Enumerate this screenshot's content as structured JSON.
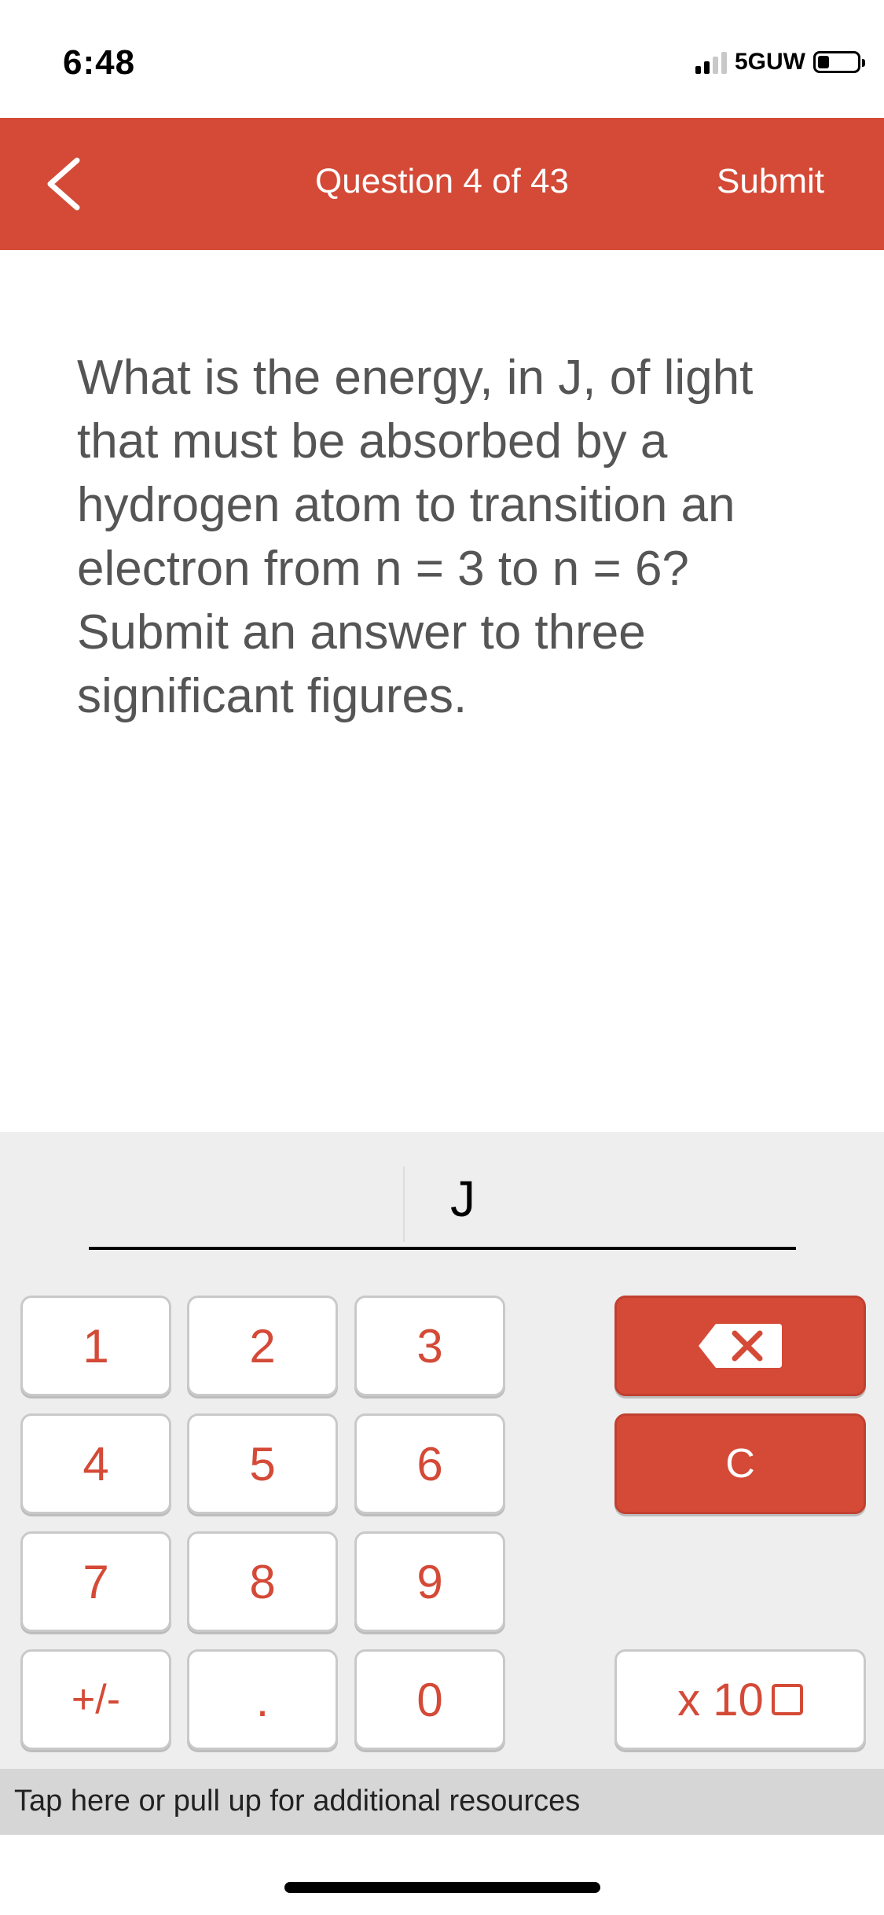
{
  "status_bar": {
    "time": "6:48",
    "network": "5GUW",
    "signal_bars_active": 2,
    "signal_bars_total": 4,
    "battery_level": 0.2
  },
  "header": {
    "back_icon": "chevron-left-icon",
    "title": "Question 4 of 43",
    "submit_label": "Submit",
    "color": "#d44a37"
  },
  "question": {
    "text": "What is the energy, in J,  of light that must be absorbed by a hydrogen atom to transition an electron from n = 3 to n = 6? Submit an answer to three significant figures."
  },
  "answer": {
    "value": "",
    "unit": "J"
  },
  "keypad": {
    "keys": {
      "k1": "1",
      "k2": "2",
      "k3": "3",
      "k4": "4",
      "k5": "5",
      "k6": "6",
      "k7": "7",
      "k8": "8",
      "k9": "9",
      "sign": "+/-",
      "decimal": ".",
      "k0": "0"
    },
    "backspace_icon": "backspace-icon",
    "clear_label": "C",
    "x10_label": "x 10"
  },
  "resources": {
    "label": "Tap here or pull up for additional resources"
  }
}
